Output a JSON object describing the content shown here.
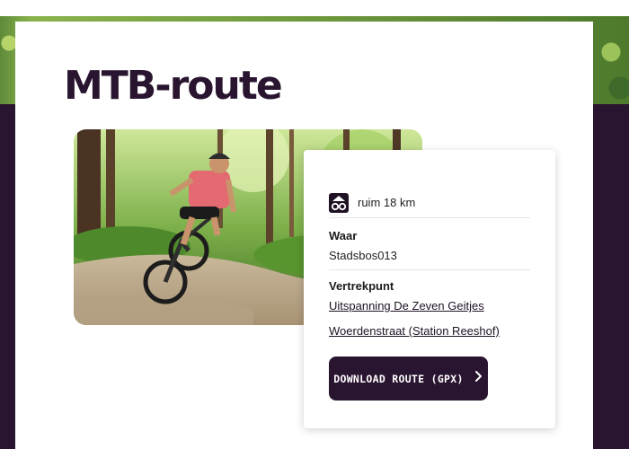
{
  "page": {
    "title": "MTB-route"
  },
  "route": {
    "distance_icon": "mtb-icon",
    "distance_text": "ruim 18 km",
    "waar_label": "Waar",
    "waar_value": "Stadsbos013",
    "vertrek_label": "Vertrekpunt",
    "vertrek_links": [
      {
        "label": "Uitspanning De Zeven Geitjes"
      },
      {
        "label": "Woerdenstraat (Station Reeshof)"
      }
    ],
    "download_label": "DOWNLOAD ROUTE (GPX)",
    "download_icon": "chevron-right-icon"
  },
  "colors": {
    "brand_dark": "#2a1530",
    "accent_text": "#1e1224"
  }
}
